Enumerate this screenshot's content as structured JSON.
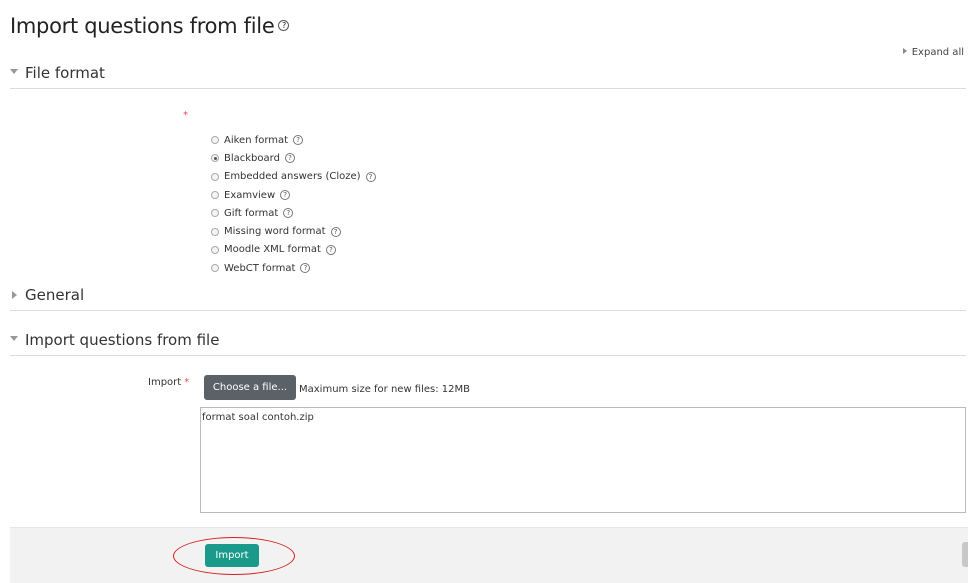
{
  "page_title": "Import questions from file",
  "expand_all_label": "Expand all",
  "sections": {
    "file_format": "File format",
    "general": "General",
    "import_questions": "Import questions from file"
  },
  "required_marker": "*",
  "formats": [
    {
      "label": "Aiken format",
      "checked": false
    },
    {
      "label": "Blackboard",
      "checked": true
    },
    {
      "label": "Embedded answers (Cloze)",
      "checked": false
    },
    {
      "label": "Examview",
      "checked": false
    },
    {
      "label": "Gift format",
      "checked": false
    },
    {
      "label": "Missing word format",
      "checked": false
    },
    {
      "label": "Moodle XML format",
      "checked": false
    },
    {
      "label": "WebCT format",
      "checked": false
    }
  ],
  "help_glyph": "?",
  "import_field": {
    "label": "Import",
    "choose_button": "Choose a file...",
    "max_size_text": "Maximum size for new files: 12MB",
    "file_name": "format soal contoh.zip"
  },
  "import_button": "Import",
  "colors": {
    "import_button": "#1a9a8a",
    "choose_button": "#5a6268",
    "required": "#d9534f",
    "highlight": "#d42020"
  }
}
